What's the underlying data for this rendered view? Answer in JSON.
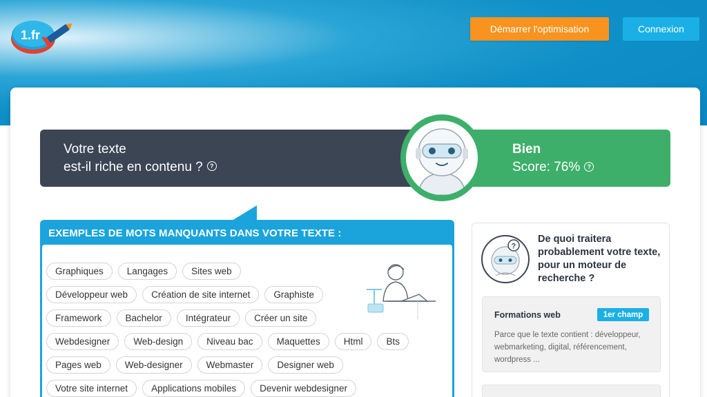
{
  "header": {
    "logo_text": "1.fr",
    "start_button": "Démarrer l'optimisation",
    "login_button": "Connexion"
  },
  "banner": {
    "question_line1": "Votre texte",
    "question_line2": "est-il riche en contenu ?",
    "rating": "Bien",
    "score": "Score: 76%",
    "help_symbol": "?"
  },
  "missing_words": {
    "title": "EXEMPLES DE MOTS MANQUANTS DANS VOTRE TEXTE :",
    "rows": [
      [
        "Graphiques",
        "Langages",
        "Sites web"
      ],
      [
        "Développeur web",
        "Création de site internet",
        "Graphiste"
      ],
      [
        "Framework",
        "Bachelor",
        "Intégrateur",
        "Créer un site"
      ],
      [
        "Webdesigner",
        "Web-design",
        "Niveau bac",
        "Maquettes",
        "Html",
        "Bts"
      ],
      [
        "Pages web",
        "Web-designer",
        "Webmaster",
        "Designer web"
      ],
      [
        "Votre site internet",
        "Applications mobiles",
        "Devenir webdesigner"
      ]
    ]
  },
  "topic": {
    "question": "De quoi traitera probablement votre texte, pour un moteur de recherche ?",
    "card": {
      "name": "Formations web",
      "badge": "1er champ",
      "reason": "Parce que le texte contient : développeur, webmarketing, digital, référencement, wordpress ..."
    }
  },
  "colors": {
    "header_blue": "#0f8fc7",
    "orange": "#f7931e",
    "login_blue": "#1ab0e6",
    "dark_banner": "#3b4554",
    "green": "#3daf6a",
    "panel_blue": "#1aa4db"
  }
}
